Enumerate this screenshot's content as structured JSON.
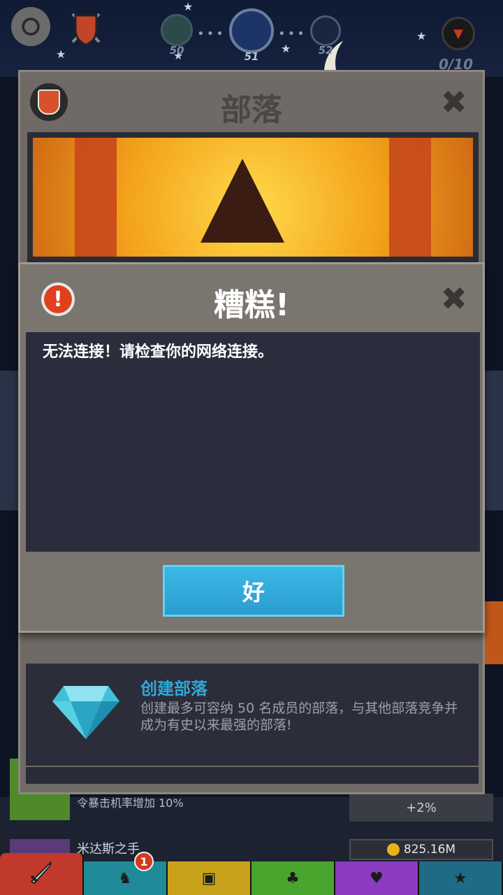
{
  "hud": {
    "stages": [
      "50",
      "51",
      "52"
    ],
    "boss_progress": "0/10"
  },
  "clan_panel": {
    "title": "部落",
    "close_icon": "close-icon",
    "create_clan": {
      "title": "创建部落",
      "description": "创建最多可容纳 50 名成员的部落，与其他部落竞争并成为有史以来最强的部落!"
    }
  },
  "dialog": {
    "title": "糟糕!",
    "message": "无法连接！请检查你的网络连接。",
    "ok_label": "好",
    "icon": "error-icon",
    "close_icon": "close-icon"
  },
  "background_list": {
    "crit_text": "令暴击机率增加 10%",
    "crit_value": "+2%",
    "midas_label": "米达斯之手",
    "midas_price": "825.16M"
  },
  "tabs": {
    "heroes_badge": "1",
    "icons": [
      "sword-icon",
      "heroes-icon",
      "shop-icon",
      "pets-icon",
      "relics-icon",
      "star-icon"
    ]
  },
  "colors": {
    "dialog_bg": "#7a756f",
    "body_bg": "#2c2d3c",
    "ok_button": "#2a9cd0",
    "error_red": "#e0401d",
    "create_title": "#30a8d6"
  }
}
